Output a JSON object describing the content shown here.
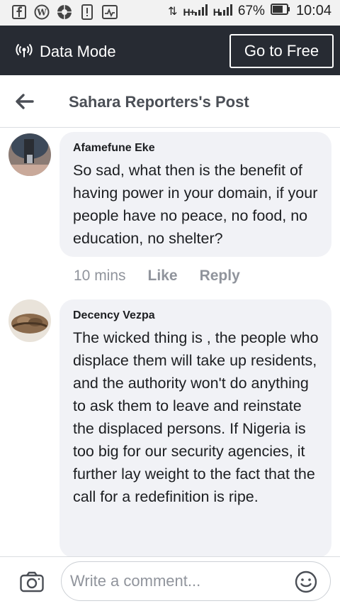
{
  "status_bar": {
    "battery": "67%",
    "time": "10:04",
    "signal_1": "H+",
    "signal_2": "H"
  },
  "data_bar": {
    "label": "Data Mode",
    "go_free": "Go to Free"
  },
  "header": {
    "title": "Sahara Reporters's Post"
  },
  "comments": [
    {
      "name": "Afamefune Eke",
      "text": "So sad, what then is the benefit of having power in your domain, if your people have no peace, no food, no education, no shelter?",
      "time": "10 mins",
      "like": "Like",
      "reply": "Reply"
    },
    {
      "name": "Decency Vezpa",
      "text": "The wicked thing is , the people who displace them will take up residents, and the authority won't do anything to ask them to leave and reinstate the displaced persons. If Nigeria is too big for our security agencies, it further lay weight to the fact that the call for a redefinition is ripe."
    }
  ],
  "compose": {
    "placeholder": "Write a comment..."
  },
  "colors": {
    "data_bar_bg": "#272b33",
    "bubble_bg": "#f1f2f6",
    "muted_text": "#90949c"
  }
}
